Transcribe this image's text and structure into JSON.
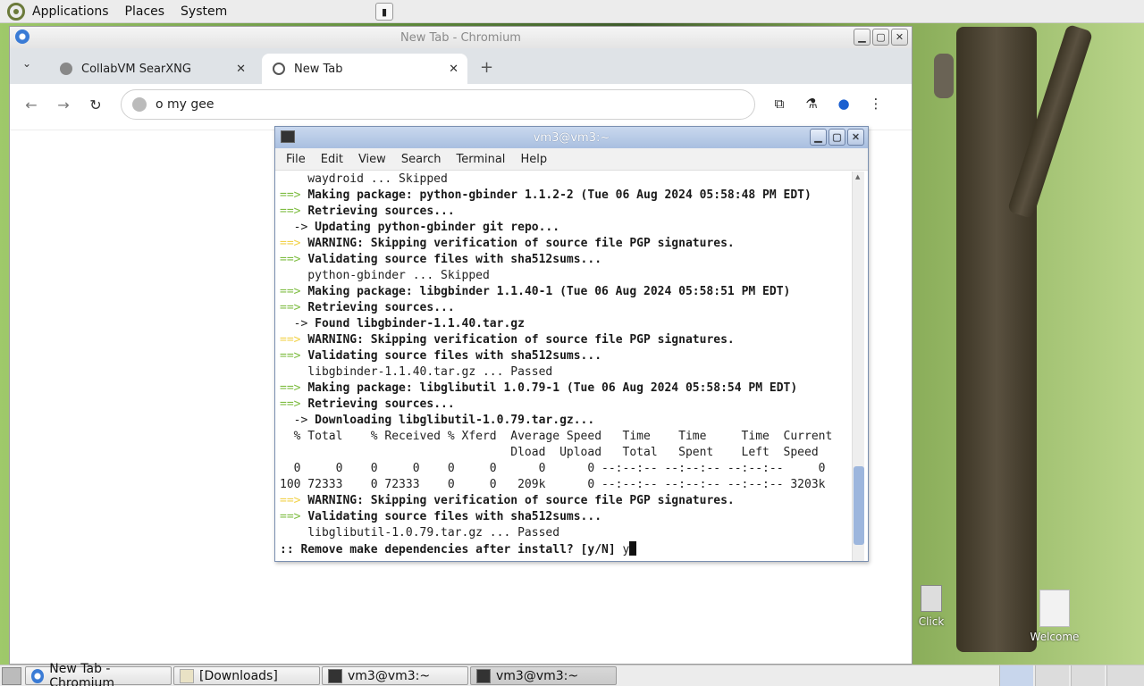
{
  "top_panel": {
    "menus": [
      "Applications",
      "Places",
      "System"
    ]
  },
  "browser": {
    "window_title": "New Tab - Chromium",
    "tabs": [
      {
        "label": "CollabVM SearXNG"
      },
      {
        "label": "New Tab"
      }
    ],
    "omnibox_value": "o my gee"
  },
  "terminal": {
    "window_title": "vm3@vm3:~",
    "menus": [
      "File",
      "Edit",
      "View",
      "Search",
      "Terminal",
      "Help"
    ],
    "lines": [
      {
        "type": "plain",
        "text": "    waydroid ... Skipped"
      },
      {
        "type": "arrow",
        "prefix": "==> ",
        "text": "Making package: python-gbinder 1.1.2-2 (Tue 06 Aug 2024 05:58:48 PM EDT)"
      },
      {
        "type": "arrow",
        "prefix": "==> ",
        "text": "Retrieving sources..."
      },
      {
        "type": "sub",
        "prefix": "  -> ",
        "text": "Updating python-gbinder git repo..."
      },
      {
        "type": "warn",
        "prefix": "==> ",
        "tag": "WARNING:",
        "text": " Skipping verification of source file PGP signatures."
      },
      {
        "type": "arrow",
        "prefix": "==> ",
        "text": "Validating source files with sha512sums..."
      },
      {
        "type": "plain",
        "text": "    python-gbinder ... Skipped"
      },
      {
        "type": "arrow",
        "prefix": "==> ",
        "text": "Making package: libgbinder 1.1.40-1 (Tue 06 Aug 2024 05:58:51 PM EDT)"
      },
      {
        "type": "arrow",
        "prefix": "==> ",
        "text": "Retrieving sources..."
      },
      {
        "type": "sub",
        "prefix": "  -> ",
        "text": "Found libgbinder-1.1.40.tar.gz"
      },
      {
        "type": "warn",
        "prefix": "==> ",
        "tag": "WARNING:",
        "text": " Skipping verification of source file PGP signatures."
      },
      {
        "type": "arrow",
        "prefix": "==> ",
        "text": "Validating source files with sha512sums..."
      },
      {
        "type": "plain",
        "text": "    libgbinder-1.1.40.tar.gz ... Passed"
      },
      {
        "type": "arrow",
        "prefix": "==> ",
        "text": "Making package: libglibutil 1.0.79-1 (Tue 06 Aug 2024 05:58:54 PM EDT)"
      },
      {
        "type": "arrow",
        "prefix": "==> ",
        "text": "Retrieving sources..."
      },
      {
        "type": "sub",
        "prefix": "  -> ",
        "text": "Downloading libglibutil-1.0.79.tar.gz..."
      },
      {
        "type": "plain",
        "text": "  % Total    % Received % Xferd  Average Speed   Time    Time     Time  Current"
      },
      {
        "type": "plain",
        "text": "                                 Dload  Upload   Total   Spent    Left  Speed"
      },
      {
        "type": "plain",
        "text": "  0     0    0     0    0     0      0      0 --:--:-- --:--:-- --:--:--     0"
      },
      {
        "type": "plain",
        "text": "100 72333    0 72333    0     0   209k      0 --:--:-- --:--:-- --:--:-- 3203k"
      },
      {
        "type": "warn",
        "prefix": "==> ",
        "tag": "WARNING:",
        "text": " Skipping verification of source file PGP signatures."
      },
      {
        "type": "arrow",
        "prefix": "==> ",
        "text": "Validating source files with sha512sums..."
      },
      {
        "type": "plain",
        "text": "    libglibutil-1.0.79.tar.gz ... Passed"
      },
      {
        "type": "prompt",
        "text": ":: Remove make dependencies after install? [y/N] ",
        "input": "y"
      }
    ]
  },
  "desktop_icons": [
    {
      "label": "Click"
    },
    {
      "label": "Welcome"
    }
  ],
  "taskbar": {
    "tasks": [
      {
        "label": "New Tab - Chromium",
        "icon": "chromium-icon"
      },
      {
        "label": "[Downloads]",
        "icon": "folder-icon"
      },
      {
        "label": "vm3@vm3:~",
        "icon": "terminal-icon"
      },
      {
        "label": "vm3@vm3:~",
        "icon": "terminal-icon"
      }
    ]
  },
  "colors": {
    "arrow": "#7fbd43",
    "warning": "#f2d24a",
    "terminal_title": "#a9bfe0"
  }
}
